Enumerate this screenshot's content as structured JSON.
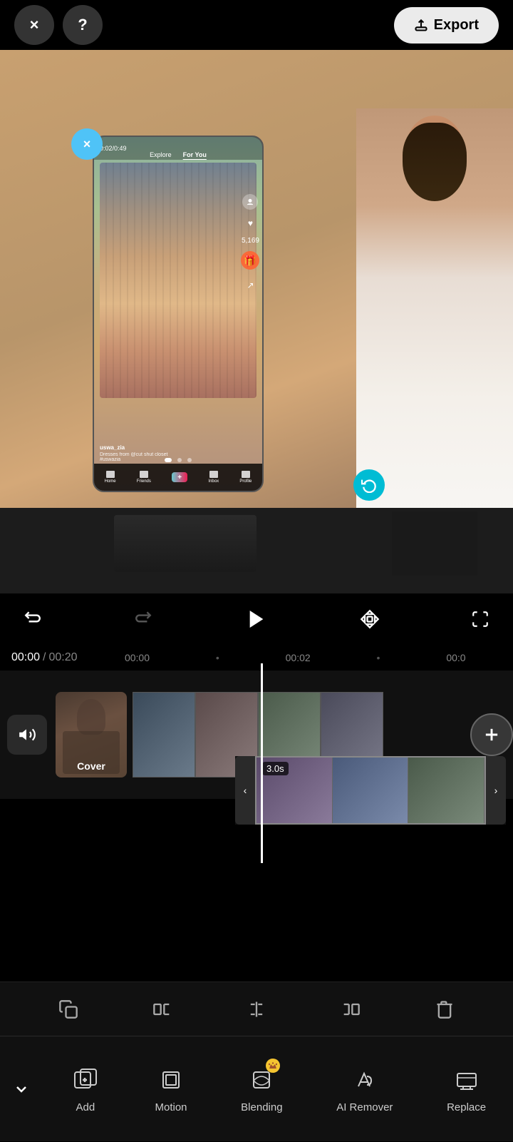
{
  "header": {
    "close_label": "×",
    "help_label": "?",
    "export_label": "Export"
  },
  "preview": {
    "close_overlay_label": "×",
    "rotate_label": "↺"
  },
  "controls": {
    "undo_label": "↺",
    "redo_label": "↻",
    "play_label": "▶",
    "diamond_label": "◇",
    "fullscreen_label": "⛶"
  },
  "timeline": {
    "current_time": "00:00",
    "separator": "/",
    "total_time": "00:20",
    "marker1": "00:00",
    "marker2": "00:02"
  },
  "clips": {
    "cover_label": "Cover",
    "track_duration": "3.0s",
    "add_label": "+"
  },
  "edit_toolbar": {
    "copy_label": "⧉",
    "split_left_label": "⊣",
    "split_center_label": "⊢",
    "split_right_label": "⊣",
    "delete_label": "🗑"
  },
  "bottom_nav": {
    "down_label": "∨",
    "add_label": "Add",
    "motion_label": "Motion",
    "blending_label": "Blending",
    "ai_remover_label": "AI Remover",
    "replace_label": "Replace"
  },
  "phone_overlay": {
    "username": "uswa_zia",
    "description": "Dresses from @cut shut closet",
    "hashtag": "#uswazia",
    "time": "0:02/0:49"
  }
}
